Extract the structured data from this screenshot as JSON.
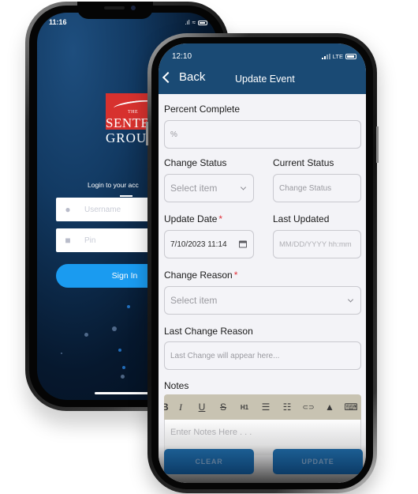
{
  "login_phone": {
    "status_time": "11:16",
    "logo": {
      "line1": "THE",
      "line2": "SENTE",
      "line3": "GROUP"
    },
    "caption": "Login to your acc",
    "username_placeholder": "Username",
    "pin_placeholder": "Pin",
    "signin_label": "Sign In",
    "colors": {
      "signin": "#1a9bf0",
      "logo_red": "#d7312e",
      "background": "#0a2442"
    }
  },
  "event_phone": {
    "status_time": "12:10",
    "network": "LTE",
    "header": {
      "back_label": "Back",
      "title": "Update Event"
    },
    "fields": {
      "percent_complete": {
        "label": "Percent Complete",
        "placeholder": "%"
      },
      "change_status": {
        "label": "Change Status",
        "placeholder": "Select item"
      },
      "current_status": {
        "label": "Current Status",
        "placeholder": "Change Status"
      },
      "update_date": {
        "label": "Update Date",
        "required_mark": "*",
        "value": "7/10/2023 11:14"
      },
      "last_updated": {
        "label": "Last Updated",
        "placeholder": "MM/DD/YYYY hh:mm"
      },
      "change_reason": {
        "label": "Change Reason",
        "required_mark": "*",
        "placeholder": "Select item"
      },
      "last_change_reason": {
        "label": "Last Change Reason",
        "placeholder": "Last Change will appear here..."
      },
      "notes": {
        "label": "Notes",
        "placeholder": "Enter Notes Here . . ."
      }
    },
    "toolbar": [
      {
        "icon": "bold-icon",
        "glyph": "B"
      },
      {
        "icon": "italic-icon",
        "glyph": "I"
      },
      {
        "icon": "underline-icon",
        "glyph": "U"
      },
      {
        "icon": "strikethrough-icon",
        "glyph": "S"
      },
      {
        "icon": "heading1-icon",
        "glyph": "H1"
      },
      {
        "icon": "bullet-list-icon",
        "glyph": "☰"
      },
      {
        "icon": "numbered-list-icon",
        "glyph": "☷"
      },
      {
        "icon": "link-icon",
        "glyph": "⊂⊃"
      },
      {
        "icon": "image-icon",
        "glyph": "▲"
      },
      {
        "icon": "keyboard-icon",
        "glyph": "⌨"
      }
    ],
    "buttons": {
      "clear": "CLEAR",
      "update": "UPDATE"
    },
    "colors": {
      "header": "#1a4a74",
      "required": "#e0313a",
      "toolbar": "#c8c3b2",
      "button": "#0c3b66"
    }
  }
}
